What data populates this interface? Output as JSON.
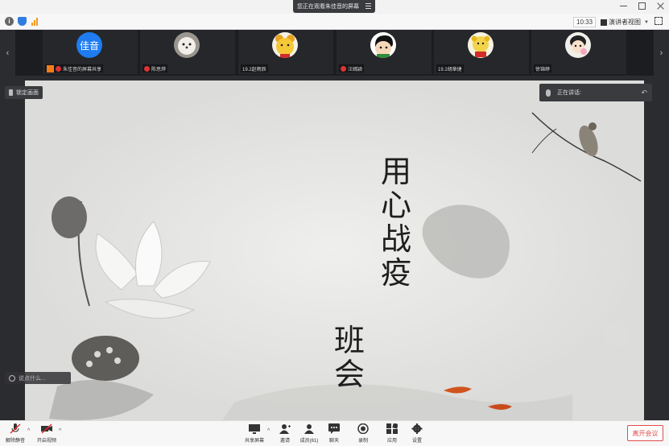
{
  "window": {
    "viewing_label": "您正在观看朱佳音的屏幕"
  },
  "toolbar": {
    "time": "10:33",
    "view_mode": "演讲者视图"
  },
  "participants": [
    {
      "avatar_text": "佳音",
      "name": "朱佳音的屏幕共享",
      "avatar_color": "#1f7cf2"
    },
    {
      "avatar_text": "",
      "name": "陈思烨",
      "avatar_color": "#cfc8c0"
    },
    {
      "avatar_text": "",
      "name": "19.2赵雨辰",
      "avatar_color": "#f5c838"
    },
    {
      "avatar_text": "",
      "name": "汪嫣颖",
      "avatar_color": "#ffffff"
    },
    {
      "avatar_text": "",
      "name": "19.2胡章捷",
      "avatar_color": "#f2d34a"
    },
    {
      "avatar_text": "",
      "name": "徐锦婷",
      "avatar_color": "#f1efe9"
    }
  ],
  "stage": {
    "pin_label": "锁定画面",
    "speaking_label": "正在讲话:",
    "chat_placeholder": "说点什么..."
  },
  "slide": {
    "title_col1": "用心战疫",
    "title_col2": "班会"
  },
  "bottombar": {
    "mute": "解除静音",
    "video": "开启视频",
    "share": "共享屏幕",
    "invite": "邀请",
    "members": "成员(61)",
    "chat": "聊天",
    "record": "录制",
    "apps": "应用",
    "settings": "设置",
    "leave": "离开会议"
  }
}
